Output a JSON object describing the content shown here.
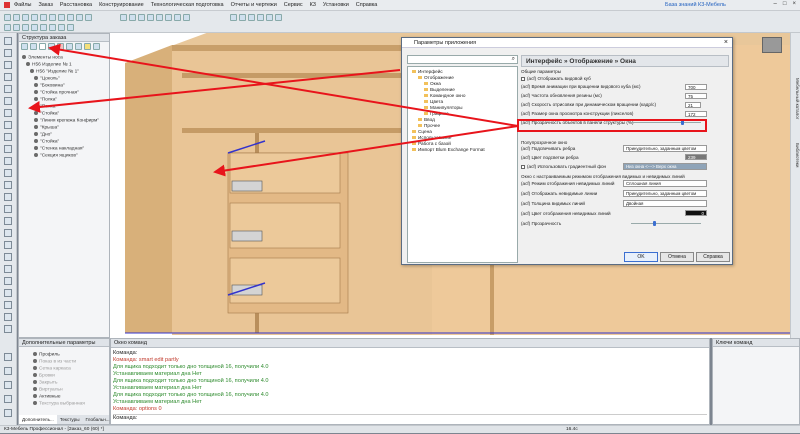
{
  "menu": {
    "items": [
      "Файлы",
      "Заказ",
      "Расстановка",
      "Конструирование",
      "Технологическая подготовка",
      "Отчеты и чертежи",
      "Сервис",
      "К3",
      "Установки",
      "Справка"
    ],
    "doc": "База знаний К3-Мебель"
  },
  "structure": {
    "title": "Структура заказа",
    "rows": [
      "Элементы носа",
      "Н56 Изделие № 1",
      "Н56 \"Изделие № 1\"",
      "\"Цоколь\"",
      "\"Боковина\"",
      "\"Стойка прочная\"",
      "\"Полка\"",
      "\"Полка\"",
      "\"Стойка\"",
      "\"Линия крепежа Конфирм\"",
      "\"Крыша\"",
      "\"Дно\"",
      "\"Стойка\"",
      "\"Стенка накладная\"",
      "\"Секция ящиков\""
    ]
  },
  "props": {
    "title": "Дополнительные параметры",
    "rows": [
      "Профиль",
      "Показ в из части",
      "Сетка каркаса",
      "Бровки",
      "Закрыть",
      "Виртуальн",
      "Активные",
      "Текстура выбранная"
    ],
    "tabs": [
      "Дополнитель...",
      "Текстуры",
      "Глобальн..."
    ]
  },
  "dialog": {
    "title": "Параметры приложения",
    "heading": "Интерфейс » Отображение » Окна",
    "tree": [
      "Интерфейс",
      "Отображение",
      "Окна",
      "Выделение",
      "Командное окно",
      "Цвета",
      "Манипуляторы",
      "Графика",
      "Ввод",
      "Прочее",
      "Сцена",
      "Использование",
      "Работа с базой",
      "Импорт Blum Exchange Format"
    ],
    "sections": {
      "general": "Общие параметры",
      "semi": "Полупрозрачное окно",
      "mode": "Окно с настраиваемым режимом отображения видимых и невидимых линий"
    },
    "params": [
      {
        "label": "(асf) Отображать видовой куб",
        "value": ""
      },
      {
        "label": "(асf) Время анимации при вращении видового куба (мс)",
        "value": "700"
      },
      {
        "label": "(асf) Частота обновления резины (мс)",
        "value": "75"
      },
      {
        "label": "(асf) Скорость отрисовки при динамическом вращении (кадр/с)",
        "value": "21"
      },
      {
        "label": "(асf) Размер окна просмотра конструкции (пикселов)",
        "value": "172"
      },
      {
        "label": "(асf) Прозрачность объектов в панели структуры (%)",
        "value": ""
      },
      {
        "label": "(асf) Подсвечивать ребра",
        "value": "Принудительно, заданным цветом"
      },
      {
        "label": "(асf) Цвет подсветки ребра",
        "value": "239"
      },
      {
        "label": "(асf) Использовать градиентный фон",
        "value": "Низ окна <---> Верх окна"
      },
      {
        "label": "(асf) Режим отображения невидимых линий",
        "value": "Сплошная линия"
      },
      {
        "label": "(асf) Отображать невидимые линии",
        "value": "Принудительно, заданным цветом"
      },
      {
        "label": "(асf) Толщина видимых линий",
        "value": "Двойная"
      },
      {
        "label": "(асf) Цвет отображения невидимых линий",
        "value": "0"
      },
      {
        "label": "(асf) Прозрачность",
        "value": ""
      }
    ],
    "buttons": {
      "ok": "OK",
      "cancel": "Отмена",
      "help": "Справка"
    }
  },
  "command": {
    "title": "Окно команд",
    "lines": [
      {
        "text": "Команда:",
        "color": "#222222"
      },
      {
        "text": "Команда: smart edit partly",
        "color": "#c0392b"
      },
      {
        "text": "Для ящика подходит только дно толщиной 16, получили 4.0",
        "color": "#2e8b2e"
      },
      {
        "text": "Устанавливаем материал дна Нет",
        "color": "#2e8b2e"
      },
      {
        "text": "Для ящика подходит только дно толщиной 16, получили 4.0",
        "color": "#2e8b2e"
      },
      {
        "text": "Устанавливаем материал дна Нет",
        "color": "#2e8b2e"
      },
      {
        "text": "Для ящика подходит только дно толщиной 16, получили 4.0",
        "color": "#2e8b2e"
      },
      {
        "text": "Устанавливаем материал дна Нет",
        "color": "#2e8b2e"
      },
      {
        "text": "Команда: options 0",
        "color": "#c0392b"
      },
      {
        "text": "Команда:",
        "color": "#222222"
      }
    ]
  },
  "keys": {
    "title": "Ключи команд"
  },
  "status": {
    "left": "К3-Мебель Профессионал - [Заказ_60 (60) *]",
    "value": "16.4с"
  },
  "right_tabs": [
    "Мебельный каталог",
    "Библиотеки"
  ]
}
